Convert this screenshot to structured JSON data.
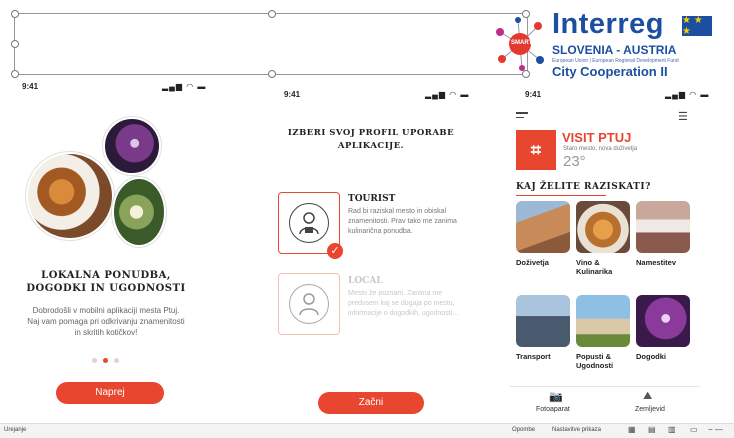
{
  "logo": {
    "word": "Interreg",
    "region": "SLOVENIA - AUSTRIA",
    "fund": "European Union | European Regional Development Fund",
    "program": "City Cooperation II",
    "badge": "SMART"
  },
  "screens": [
    {
      "time": "9:41",
      "title_line1": "LOKALNA PONUDBA,",
      "title_line2": "DOGODKI IN UGODNOSTI",
      "body": "Dobrodošli v mobilni aplikaciji mesta Ptuj. Naj vam pomaga pri odkrivanju znamenitosti in skritih kotičkov!",
      "button": "Naprej",
      "pager": {
        "count": 3,
        "active": 1
      }
    },
    {
      "time": "9:41",
      "title_line1": "IZBERI SVOJ PROFIL UPORABE",
      "title_line2": "APLIKACIJE.",
      "profiles": [
        {
          "title": "TOURIST",
          "desc": "Rad bi raziskal mesto in obiskal znamenitosti. Prav tako me zanima kulinarična ponudba."
        },
        {
          "title": "LOCAL",
          "desc": "Mesto že poznam. Zanima me predvsem kaj se dogaja po mestu, informacije o dogodkih, ugodnosti..."
        }
      ],
      "button": "Začni"
    },
    {
      "time": "9:41",
      "brand": "VISIT PTUJ",
      "tagline": "Staro mesto, nova doživetja",
      "temperature": "23°",
      "section_title": "KAJ ŽELITE RAZISKATI?",
      "tiles": [
        {
          "label": "Doživetja",
          "color": "#b86f4c"
        },
        {
          "label": "Vino & Kulinarika",
          "color": "#c9894a"
        },
        {
          "label": "Namestitev",
          "color": "#8a5a4e"
        },
        {
          "label": "Transport",
          "color": "#5b6f86"
        },
        {
          "label": "Popusti & Ugodnosti",
          "color": "#5f93b8"
        },
        {
          "label": "Dogodki",
          "color": "#6a2c6f"
        }
      ],
      "tabs": [
        {
          "label": "Fotoaparat",
          "icon": "camera-icon"
        },
        {
          "label": "Zemljevid",
          "icon": "map-icon"
        }
      ]
    }
  ],
  "statusbar": {
    "left": "Urejanje",
    "notes": "Opombe",
    "display": "Nastavitve prikaza"
  },
  "colors": {
    "accent": "#e8462e",
    "brand_blue": "#1d4fa0"
  }
}
